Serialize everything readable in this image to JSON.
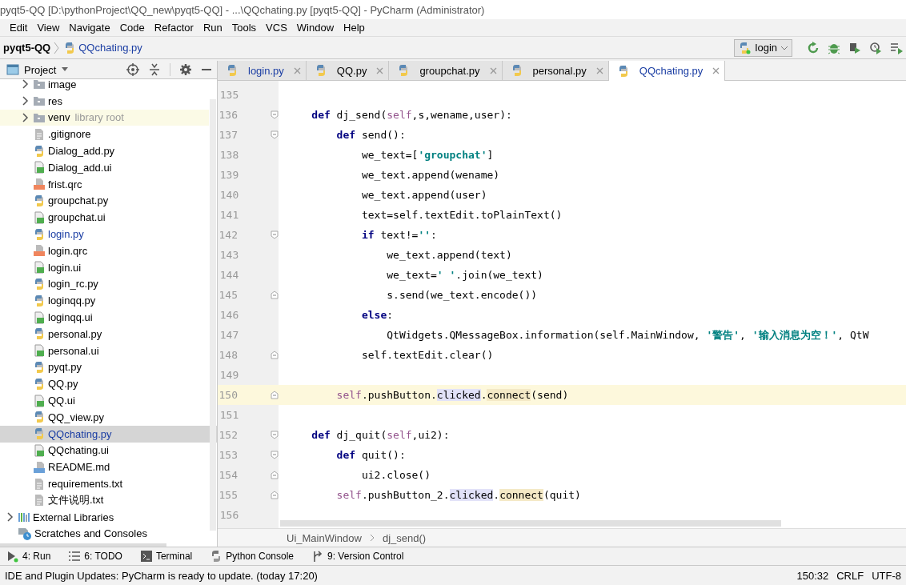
{
  "window": {
    "title": "pyqt5-QQ [D:\\pythonProject\\QQ_new\\pyqt5-QQ] - ...\\QQchating.py [pyqt5-QQ] - PyCharm (Administrator)"
  },
  "menu": [
    "Edit",
    "View",
    "Navigate",
    "Code",
    "Refactor",
    "Run",
    "Tools",
    "VCS",
    "Window",
    "Help"
  ],
  "navbar": {
    "project": "pyqt5-QQ",
    "file": "QQchating.py",
    "run_config": "login"
  },
  "project_panel": {
    "title": "Project",
    "tree": [
      {
        "children": [
          {
            "label": "image",
            "kind": "folder",
            "expanded": false
          },
          {
            "label": "res",
            "kind": "folder",
            "expanded": false
          },
          {
            "label": "venv",
            "kind": "folder",
            "expanded": false,
            "note": "library root"
          },
          {
            "label": ".gitignore",
            "kind": "text",
            "selected": false,
            "modified": false
          },
          {
            "label": "Dialog_add.py",
            "kind": "py",
            "selected": false,
            "modified": false
          },
          {
            "label": "Dialog_add.ui",
            "kind": "ui",
            "selected": false,
            "modified": false
          },
          {
            "label": "frist.qrc",
            "kind": "qrc",
            "selected": false,
            "modified": false
          },
          {
            "label": "groupchat.py",
            "kind": "py",
            "selected": false,
            "modified": false
          },
          {
            "label": "groupchat.ui",
            "kind": "ui",
            "selected": false,
            "modified": false
          },
          {
            "label": "login.py",
            "kind": "py",
            "selected": false,
            "modified": true
          },
          {
            "label": "login.qrc",
            "kind": "qrc",
            "selected": false,
            "modified": false
          },
          {
            "label": "login.ui",
            "kind": "ui",
            "selected": false,
            "modified": false
          },
          {
            "label": "login_rc.py",
            "kind": "py",
            "selected": false,
            "modified": false
          },
          {
            "label": "loginqq.py",
            "kind": "py",
            "selected": false,
            "modified": false
          },
          {
            "label": "loginqq.ui",
            "kind": "ui",
            "selected": false,
            "modified": false
          },
          {
            "label": "personal.py",
            "kind": "py",
            "selected": false,
            "modified": false
          },
          {
            "label": "personal.ui",
            "kind": "ui",
            "selected": false,
            "modified": false
          },
          {
            "label": "pyqt.py",
            "kind": "py",
            "selected": false,
            "modified": false
          },
          {
            "label": "QQ.py",
            "kind": "py",
            "selected": false,
            "modified": false
          },
          {
            "label": "QQ.ui",
            "kind": "ui",
            "selected": false,
            "modified": false
          },
          {
            "label": "QQ_view.py",
            "kind": "py",
            "selected": false,
            "modified": false
          },
          {
            "label": "QQchating.py",
            "kind": "py",
            "selected": true,
            "modified": true
          },
          {
            "label": "QQchating.ui",
            "kind": "ui",
            "selected": false,
            "modified": false
          },
          {
            "label": "README.md",
            "kind": "md",
            "selected": false,
            "modified": false
          },
          {
            "label": "requirements.txt",
            "kind": "text",
            "selected": false,
            "modified": false
          },
          {
            "label": "文件说明.txt",
            "kind": "text",
            "selected": false,
            "modified": false
          }
        ]
      },
      {
        "label": "External Libraries",
        "kind": "libraries",
        "expanded": false
      },
      {
        "label": "Scratches and Consoles",
        "kind": "scratches"
      }
    ]
  },
  "tabs": [
    {
      "label": "login.py",
      "selected": false,
      "modified": true
    },
    {
      "label": "QQ.py",
      "selected": false,
      "modified": false
    },
    {
      "label": "groupchat.py",
      "selected": false,
      "modified": false
    },
    {
      "label": "personal.py",
      "selected": false,
      "modified": false
    },
    {
      "label": "QQchating.py",
      "selected": true,
      "modified": true
    }
  ],
  "code": [
    {
      "number": "135",
      "fold_start": false,
      "fold_end": false,
      "current": false
    },
    {
      "number": "136",
      "fold_start": true,
      "fold_end": false,
      "current": false,
      "tokens": [
        {
          "text": "    def",
          "kind": "kw"
        },
        {
          "text": " dj_send(",
          "kind": "plain"
        },
        {
          "text": "self",
          "kind": "self"
        },
        {
          "text": ",s,wename,user):",
          "kind": "plain"
        }
      ]
    },
    {
      "number": "137",
      "fold_start": true,
      "fold_end": false,
      "current": false,
      "tokens": [
        {
          "text": "        def",
          "kind": "kw"
        },
        {
          "text": " send():",
          "kind": "plain"
        }
      ]
    },
    {
      "number": "138",
      "fold_start": false,
      "fold_end": false,
      "current": false,
      "tokens": [
        {
          "text": "            we_text=[",
          "kind": "plain"
        },
        {
          "text": "'groupchat'",
          "kind": "str"
        },
        {
          "text": "]",
          "kind": "plain"
        }
      ]
    },
    {
      "number": "139",
      "fold_start": false,
      "fold_end": false,
      "current": false,
      "tokens": [
        {
          "text": "            we_text.append(wename)",
          "kind": "plain"
        }
      ]
    },
    {
      "number": "140",
      "fold_start": false,
      "fold_end": false,
      "current": false,
      "tokens": [
        {
          "text": "            we_text.append(user)",
          "kind": "plain"
        }
      ]
    },
    {
      "number": "141",
      "fold_start": false,
      "fold_end": false,
      "current": false,
      "tokens": [
        {
          "text": "            text=self.textEdit.toPlainText()",
          "kind": "plain"
        }
      ]
    },
    {
      "number": "142",
      "fold_start": true,
      "fold_end": false,
      "current": false,
      "tokens": [
        {
          "text": "            if",
          "kind": "kw"
        },
        {
          "text": " text!=",
          "kind": "plain"
        },
        {
          "text": "''",
          "kind": "str"
        },
        {
          "text": ":",
          "kind": "plain"
        }
      ]
    },
    {
      "number": "143",
      "fold_start": false,
      "fold_end": false,
      "current": false,
      "tokens": [
        {
          "text": "                we_text.append(text)",
          "kind": "plain"
        }
      ]
    },
    {
      "number": "144",
      "fold_start": false,
      "fold_end": false,
      "current": false,
      "tokens": [
        {
          "text": "                we_text=",
          "kind": "plain"
        },
        {
          "text": "' '",
          "kind": "str"
        },
        {
          "text": ".join(we_text)",
          "kind": "plain"
        }
      ]
    },
    {
      "number": "145",
      "fold_start": false,
      "fold_end": true,
      "current": false,
      "tokens": [
        {
          "text": "                s.send(we_text.encode())",
          "kind": "plain"
        }
      ]
    },
    {
      "number": "146",
      "fold_start": false,
      "fold_end": false,
      "current": false,
      "tokens": [
        {
          "text": "            else",
          "kind": "kw"
        },
        {
          "text": ":",
          "kind": "plain"
        }
      ]
    },
    {
      "number": "147",
      "fold_start": false,
      "fold_end": false,
      "current": false,
      "tokens": [
        {
          "text": "                QtWidgets.QMessageBox.information(self.MainWindow, ",
          "kind": "plain"
        },
        {
          "text": "'警告'",
          "kind": "str"
        },
        {
          "text": ", ",
          "kind": "plain"
        },
        {
          "text": "'输入消息为空！'",
          "kind": "str"
        },
        {
          "text": ", QtW",
          "kind": "plain"
        }
      ]
    },
    {
      "number": "148",
      "fold_start": false,
      "fold_end": true,
      "current": false,
      "tokens": [
        {
          "text": "            self.textEdit.clear()",
          "kind": "plain"
        }
      ]
    },
    {
      "number": "149",
      "fold_start": false,
      "fold_end": false,
      "current": false
    },
    {
      "number": "150",
      "fold_start": false,
      "fold_end": true,
      "current": true,
      "tokens": [
        {
          "text": "        self",
          "kind": "self"
        },
        {
          "text": ".pushButton.",
          "kind": "plain"
        },
        {
          "text": "clicked",
          "kind": "usage"
        },
        {
          "text": ".",
          "kind": "plain"
        },
        {
          "text": "connect",
          "kind": "write"
        },
        {
          "text": "(send)",
          "kind": "plain"
        }
      ]
    },
    {
      "number": "151",
      "fold_start": false,
      "fold_end": false,
      "current": false
    },
    {
      "number": "152",
      "fold_start": true,
      "fold_end": false,
      "current": false,
      "tokens": [
        {
          "text": "    def",
          "kind": "kw"
        },
        {
          "text": " dj_quit(",
          "kind": "plain"
        },
        {
          "text": "self",
          "kind": "self"
        },
        {
          "text": ",ui2):",
          "kind": "plain"
        }
      ]
    },
    {
      "number": "153",
      "fold_start": true,
      "fold_end": false,
      "current": false,
      "tokens": [
        {
          "text": "        def",
          "kind": "kw"
        },
        {
          "text": " quit():",
          "kind": "plain"
        }
      ]
    },
    {
      "number": "154",
      "fold_start": false,
      "fold_end": true,
      "current": false,
      "tokens": [
        {
          "text": "            ui2.close()",
          "kind": "plain"
        }
      ]
    },
    {
      "number": "155",
      "fold_start": false,
      "fold_end": true,
      "current": false,
      "tokens": [
        {
          "text": "        self",
          "kind": "self"
        },
        {
          "text": ".pushButton_2.",
          "kind": "plain"
        },
        {
          "text": "clicked",
          "kind": "usage"
        },
        {
          "text": ".",
          "kind": "plain"
        },
        {
          "text": "connect",
          "kind": "write"
        },
        {
          "text": "(quit)",
          "kind": "plain"
        }
      ]
    },
    {
      "number": "156",
      "fold_start": false,
      "fold_end": false,
      "current": false
    }
  ],
  "breadcrumb": [
    "Ui_MainWindow",
    "dj_send()"
  ],
  "tool_windows": [
    {
      "label": "4: Run",
      "kind": "run"
    },
    {
      "label": "6: TODO",
      "kind": "todo"
    },
    {
      "label": "Terminal",
      "kind": "terminal"
    },
    {
      "label": "Python Console",
      "kind": "python"
    },
    {
      "label": "9: Version Control",
      "kind": "vcs"
    }
  ],
  "status_bar": {
    "message": "IDE and Plugin Updates: PyCharm is ready to update. (today 17:20)",
    "position": "150:32",
    "line_ending": "CRLF",
    "encoding": "UTF-8"
  }
}
